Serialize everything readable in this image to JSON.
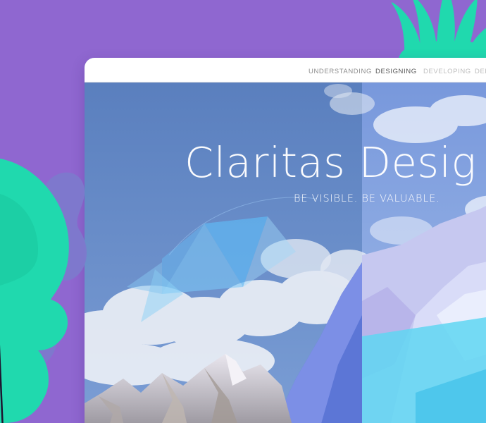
{
  "nav": {
    "items": [
      {
        "label": "UNDERSTANDING",
        "state": "default"
      },
      {
        "label": "DESIGNING",
        "state": "active"
      },
      {
        "label": "DEVELOPING",
        "state": "dim"
      },
      {
        "label": "DEL",
        "state": "dim"
      }
    ]
  },
  "hero": {
    "title": "Claritas Desig",
    "tagline": "BE VISIBLE.  BE VALUABLE.",
    "image": "mountain-landscape-with-clouds"
  },
  "decor": {
    "leaf_right": "leaf-icon",
    "leaf_left": "leaf-icon"
  },
  "colors": {
    "background": "#8f67d0",
    "leaf": "#20d9ae",
    "sky": "#5d85c2",
    "accent_blue": "#5fd6f2",
    "nav_text": "#8c8c8c"
  }
}
